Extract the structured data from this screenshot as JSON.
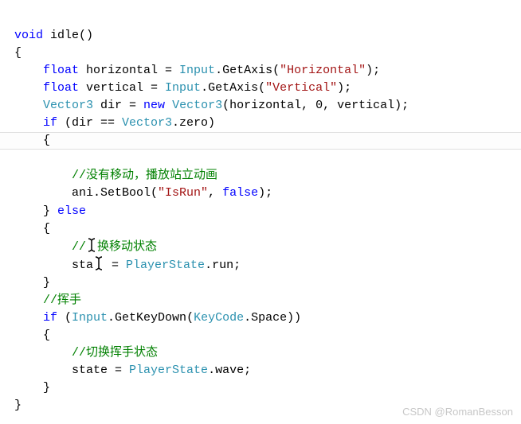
{
  "lines": {
    "l1a": "void",
    "l1b": " idle()",
    "l2": "{",
    "l3a": "    float",
    "l3b": " horizontal = ",
    "l3c": "Input",
    "l3d": ".GetAxis(",
    "l3e": "\"Horizontal\"",
    "l3f": ");",
    "l4a": "    float",
    "l4b": " vertical = ",
    "l4c": "Input",
    "l4d": ".GetAxis(",
    "l4e": "\"Vertical\"",
    "l4f": ");",
    "l5a": "    Vector3",
    "l5b": " dir = ",
    "l5c": "new",
    "l5d": " ",
    "l5e": "Vector3",
    "l5f": "(horizontal, 0, vertical);",
    "l6a": "    if",
    "l6b": " (dir == ",
    "l6c": "Vector3",
    "l6d": ".zero)",
    "l7": "    {",
    "l8a": "        //没有移动，播放站立动画",
    "l9a": "        ani.SetBool(",
    "l9b": "\"IsRun\"",
    "l9c": ", ",
    "l9d": "false",
    "l9e": ");",
    "l10a": "    } ",
    "l10b": "else",
    "l11": "    {",
    "l12a": "        //",
    "l12b": "换移动状态",
    "l13a": "        sta",
    "l13b": " = ",
    "l13c": "PlayerState",
    "l13d": ".run;",
    "l14": "    }",
    "l15a": "    //挥手",
    "l16a": "    if",
    "l16b": " (",
    "l16c": "Input",
    "l16d": ".GetKeyDown(",
    "l16e": "KeyCode",
    "l16f": ".Space))",
    "l17": "    {",
    "l18a": "        //切换挥手状态",
    "l19a": "        state = ",
    "l19b": "PlayerState",
    "l19c": ".wave;",
    "l20": "    }",
    "l21": "}"
  },
  "watermark": "CSDN @RomanBesson"
}
